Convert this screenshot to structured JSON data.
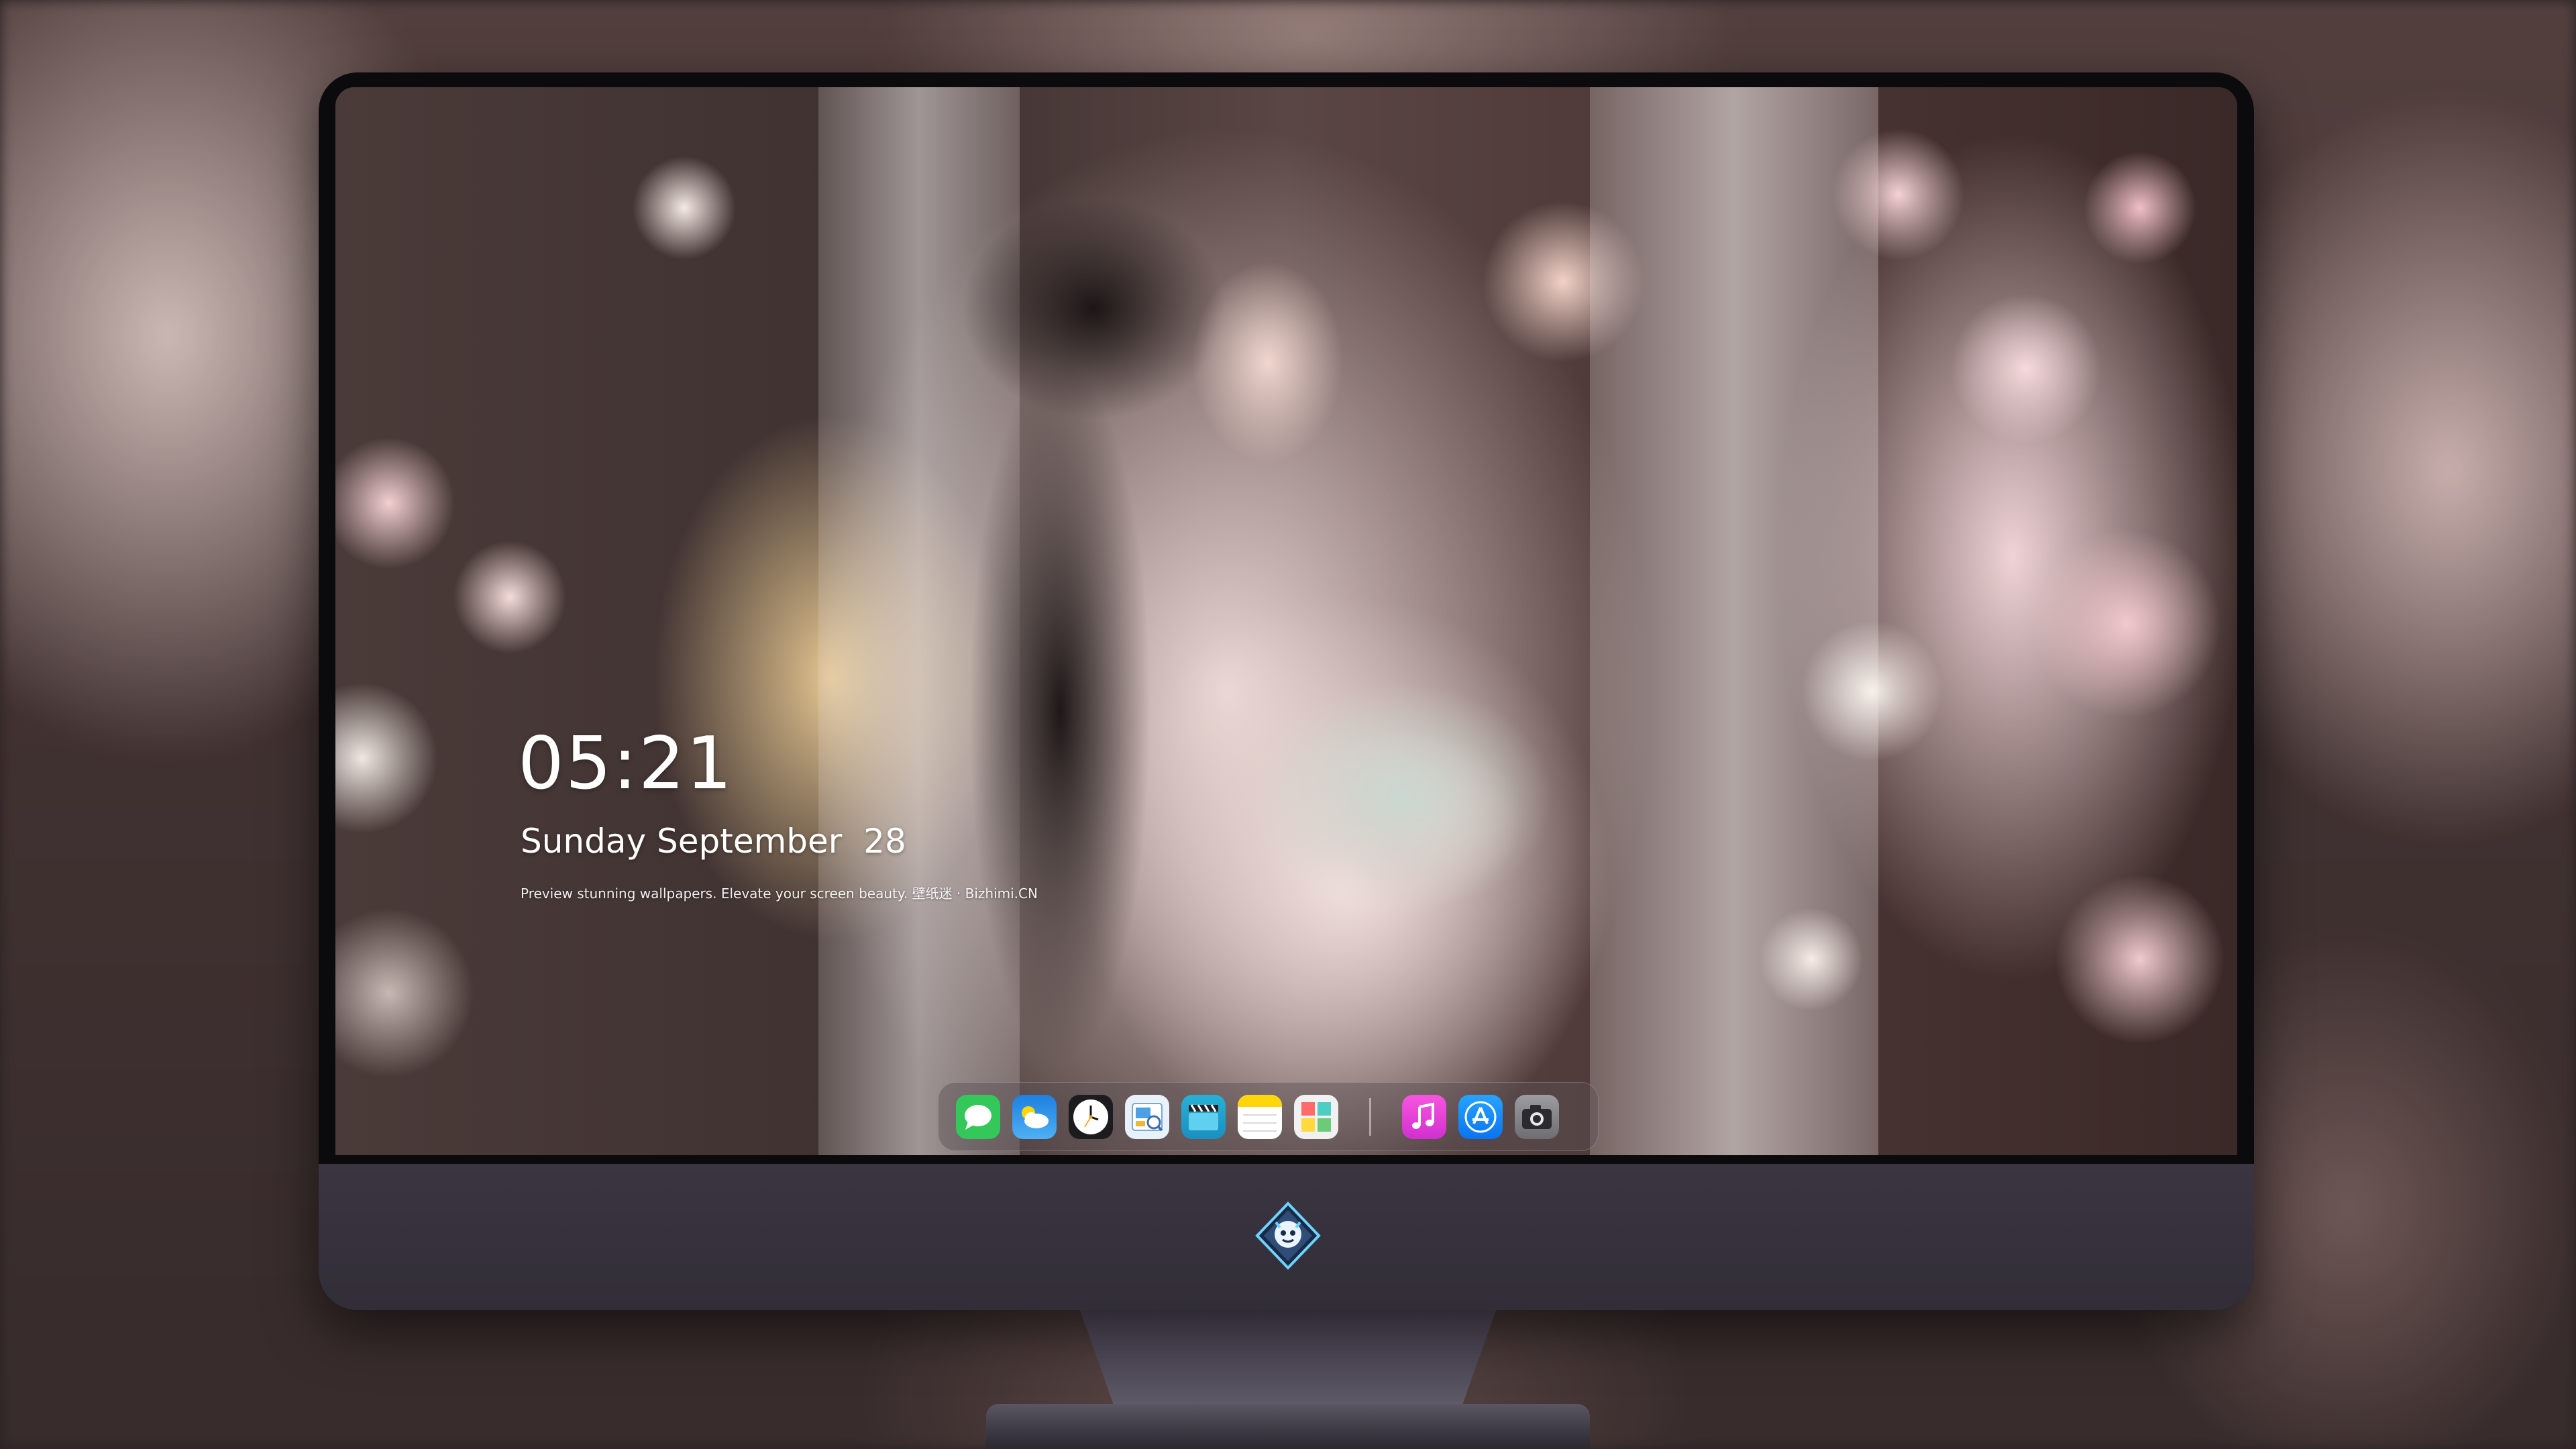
{
  "lock_screen": {
    "time": "05:21",
    "date": "Sunday September  28",
    "tagline": "Preview stunning wallpapers. Elevate your screen beauty. 壁纸迷 · Bizhimi.CN"
  },
  "dock": {
    "apps": [
      {
        "name": "Messages",
        "icon": "messages-icon",
        "color": "#34c759"
      },
      {
        "name": "Weather",
        "icon": "weather-icon",
        "color": "#2f8cf0"
      },
      {
        "name": "Clock",
        "icon": "clock-icon",
        "color": "#1c1c1e"
      },
      {
        "name": "Preview",
        "icon": "preview-icon",
        "color": "#e9f1fb"
      },
      {
        "name": "Clips",
        "icon": "clips-icon",
        "color": "#27b1d6"
      },
      {
        "name": "Notes",
        "icon": "notes-icon",
        "color": "#ffd60a"
      },
      {
        "name": "Photo Booth",
        "icon": "photos-collage-icon",
        "color": "#f1f1f1"
      }
    ],
    "recent_apps": [
      {
        "name": "Music",
        "icon": "music-icon",
        "color": "#e93ad6"
      },
      {
        "name": "App Store",
        "icon": "app-store-icon",
        "color": "#1a8cff"
      },
      {
        "name": "Camera",
        "icon": "camera-icon",
        "color": "#8e8e93"
      }
    ]
  },
  "brand": {
    "logo": "dragon-mascot-logo"
  }
}
